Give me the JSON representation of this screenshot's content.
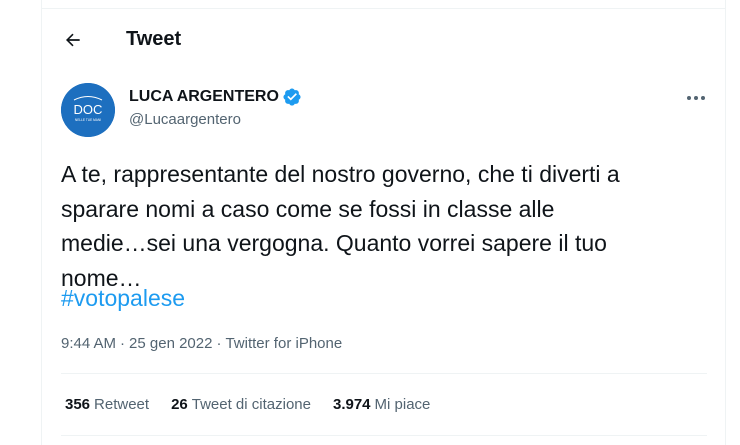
{
  "header": {
    "title": "Tweet",
    "back_icon": "arrow-left-icon"
  },
  "author": {
    "name": "LUCA ARGENTERO",
    "handle": "@Lucaargentero",
    "verified": true,
    "avatar_text": "DOC",
    "avatar_subtext": "NELLE TUE MANI",
    "avatar_color": "#1d6fbf"
  },
  "tweet": {
    "text": "A te, rappresentante del nostro governo, che ti diverti a\nsparare nomi a caso come se fossi in classe alle\nmedie…sei una vergogna. Quanto vorrei sapere il tuo\nnome…",
    "hashtag": "#votopalese",
    "time": "9:44 AM",
    "date": "25 gen 2022",
    "source": "Twitter for iPhone",
    "separator": "·"
  },
  "stats": {
    "retweets_count": "356",
    "retweets_label": "Retweet",
    "quotes_count": "26",
    "quotes_label": "Tweet di citazione",
    "likes_count": "3.974",
    "likes_label": "Mi piace"
  },
  "colors": {
    "accent": "#1d9bf0",
    "secondary_text": "#536471",
    "primary_text": "#0f1419"
  }
}
